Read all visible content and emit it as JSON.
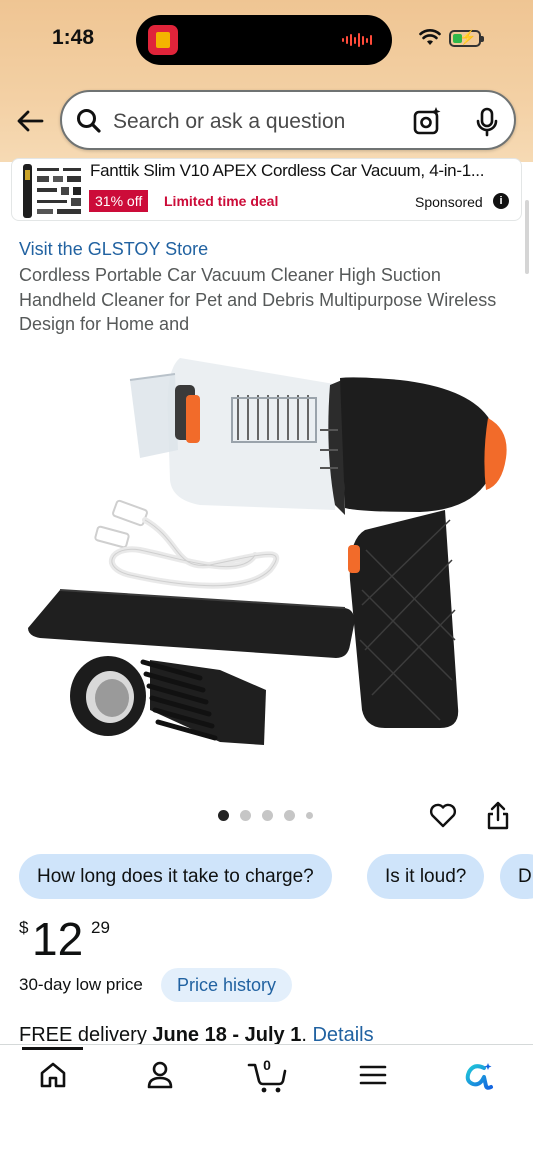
{
  "status_bar": {
    "time": "1:48"
  },
  "search": {
    "placeholder": "Search or ask a question"
  },
  "sponsored_ad": {
    "title": "Fanttik Slim V10 APEX Cordless Car Vacuum, 4-in-1...",
    "discount_badge": "31% off",
    "deal_label": "Limited time deal",
    "sponsored_label": "Sponsored",
    "info_glyph": "i"
  },
  "product": {
    "store_link": "Visit the GLSTOY Store",
    "title": "Cordless Portable Car Vacuum Cleaner High Suction Handheld Cleaner for Pet and Debris Multipurpose Wireless Design for Home and",
    "image_count": 5,
    "active_image_index": 0
  },
  "question_chips": [
    {
      "label": "How long does it take to charge?"
    },
    {
      "label": "Is it loud?"
    },
    {
      "label": "D"
    }
  ],
  "price": {
    "currency": "$",
    "whole": "12",
    "fraction": "29",
    "low_price_label": "30-day low price",
    "history_button": "Price history"
  },
  "delivery": {
    "prefix": "FREE delivery ",
    "dates": "June 18 - July 1",
    "separator": ". ",
    "details_link": "Details"
  },
  "tab_bar": {
    "cart_count": "0",
    "tabs": [
      "home-icon",
      "account-icon",
      "cart-icon",
      "menu-icon",
      "rufus-icon"
    ]
  },
  "colors": {
    "link": "#2162a1",
    "deal_red": "#cc0c39",
    "chip_bg": "#cfe4fa",
    "header_bg": "#efc593",
    "accent_orange": "#f26b2a"
  }
}
